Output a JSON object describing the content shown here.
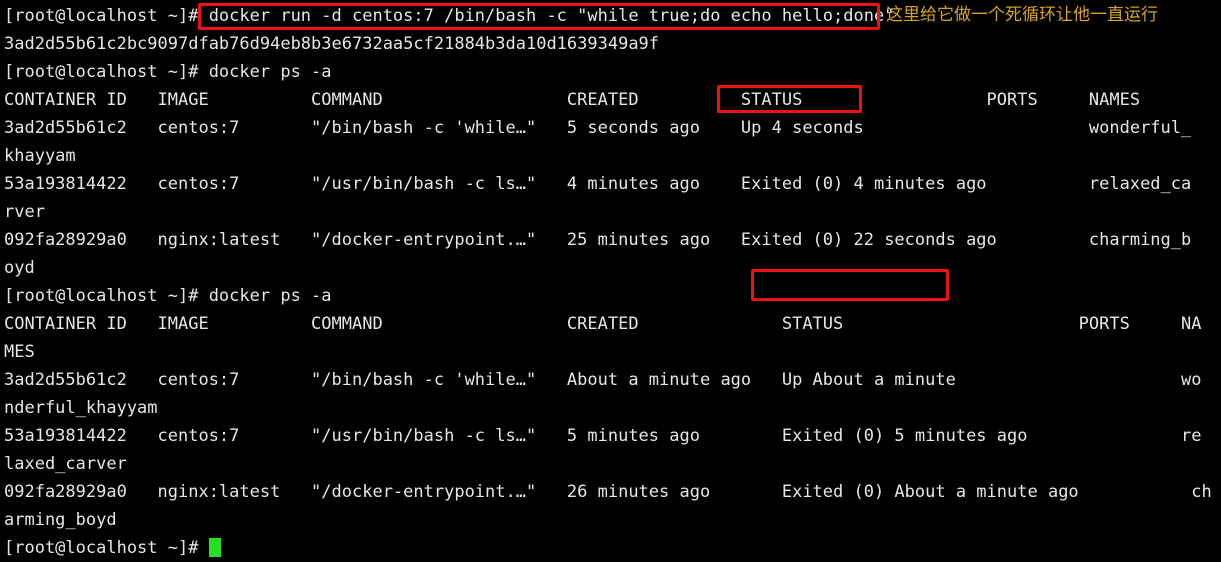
{
  "terminal": {
    "prompt": "[root@localhost ~]# ",
    "cursor_color": "#22e022",
    "background_color": "#000000",
    "foreground_color": "#e6e6e6",
    "highlight_color": "#ee1111",
    "annotation_color": "#d6a419"
  },
  "annotation": {
    "text": "这里给它做一个死循环让他一直运行"
  },
  "lines": {
    "l01": "[root@localhost ~]# docker run -d centos:7 /bin/bash -c \"while true;do echo hello;done\"",
    "l02": "3ad2d55b61c2bc9097dfab76d94eb8b3e6732aa5cf21884b3da10d1639349a9f",
    "l03": "[root@localhost ~]# docker ps -a",
    "l04": "CONTAINER ID   IMAGE          COMMAND                  CREATED          STATUS                  PORTS     NAMES",
    "l05": "3ad2d55b61c2   centos:7       \"/bin/bash -c 'while…\"   5 seconds ago    Up 4 seconds                      wonderful_",
    "l06": "khayyam",
    "l07": "53a193814422   centos:7       \"/usr/bin/bash -c ls…\"   4 minutes ago    Exited (0) 4 minutes ago          relaxed_ca",
    "l08": "rver",
    "l09": "092fa28929a0   nginx:latest   \"/docker-entrypoint.…\"   25 minutes ago   Exited (0) 22 seconds ago         charming_b",
    "l10": "oyd",
    "l11": "[root@localhost ~]# docker ps -a",
    "l12": "CONTAINER ID   IMAGE          COMMAND                  CREATED              STATUS                       PORTS     NA",
    "l13": "MES",
    "l14": "3ad2d55b61c2   centos:7       \"/bin/bash -c 'while…\"   About a minute ago   Up About a minute                      wo",
    "l15": "nderful_khayyam",
    "l16": "53a193814422   centos:7       \"/usr/bin/bash -c ls…\"   5 minutes ago        Exited (0) 5 minutes ago               re",
    "l17": "laxed_carver",
    "l18": "092fa28929a0   nginx:latest   \"/docker-entrypoint.…\"   26 minutes ago       Exited (0) About a minute ago           ch",
    "l19": "arming_boyd",
    "l20_prompt": "[root@localhost ~]# "
  },
  "commands": [
    {
      "index": 1,
      "text": "docker run -d centos:7 /bin/bash -c \"while true;do echo hello;done\"",
      "highlighted": true
    },
    {
      "index": 2,
      "text": "docker ps -a",
      "highlighted": false
    },
    {
      "index": 3,
      "text": "docker ps -a",
      "highlighted": false
    }
  ],
  "container_id_output": "3ad2d55b61c2bc9097dfab76d94eb8b3e6732aa5cf21884b3da10d1639349a9f",
  "tables": [
    {
      "name": "docker-ps-a-first",
      "columns": [
        "CONTAINER ID",
        "IMAGE",
        "COMMAND",
        "CREATED",
        "STATUS",
        "PORTS",
        "NAMES"
      ],
      "rows": [
        {
          "container_id": "3ad2d55b61c2",
          "image": "centos:7",
          "command": "\"/bin/bash -c 'while…\"",
          "created": "5 seconds ago",
          "status": "Up 4 seconds",
          "ports": "",
          "names": "wonderful_khayyam",
          "status_highlighted": true
        },
        {
          "container_id": "53a193814422",
          "image": "centos:7",
          "command": "\"/usr/bin/bash -c ls…\"",
          "created": "4 minutes ago",
          "status": "Exited (0) 4 minutes ago",
          "ports": "",
          "names": "relaxed_carver",
          "status_highlighted": false
        },
        {
          "container_id": "092fa28929a0",
          "image": "nginx:latest",
          "command": "\"/docker-entrypoint.…\"",
          "created": "25 minutes ago",
          "status": "Exited (0) 22 seconds ago",
          "ports": "",
          "names": "charming_boyd",
          "status_highlighted": false
        }
      ]
    },
    {
      "name": "docker-ps-a-second",
      "columns": [
        "CONTAINER ID",
        "IMAGE",
        "COMMAND",
        "CREATED",
        "STATUS",
        "PORTS",
        "NAMES"
      ],
      "rows": [
        {
          "container_id": "3ad2d55b61c2",
          "image": "centos:7",
          "command": "\"/bin/bash -c 'while…\"",
          "created": "About a minute ago",
          "status": "Up About a minute",
          "ports": "",
          "names": "wonderful_khayyam",
          "status_highlighted": true
        },
        {
          "container_id": "53a193814422",
          "image": "centos:7",
          "command": "\"/usr/bin/bash -c ls…\"",
          "created": "5 minutes ago",
          "status": "Exited (0) 5 minutes ago",
          "ports": "",
          "names": "relaxed_carver",
          "status_highlighted": false
        },
        {
          "container_id": "092fa28929a0",
          "image": "nginx:latest",
          "command": "\"/docker-entrypoint.…\"",
          "created": "26 minutes ago",
          "status": "Exited (0) About a minute ago",
          "ports": "",
          "names": "charming_boyd",
          "status_highlighted": false
        }
      ]
    }
  ]
}
